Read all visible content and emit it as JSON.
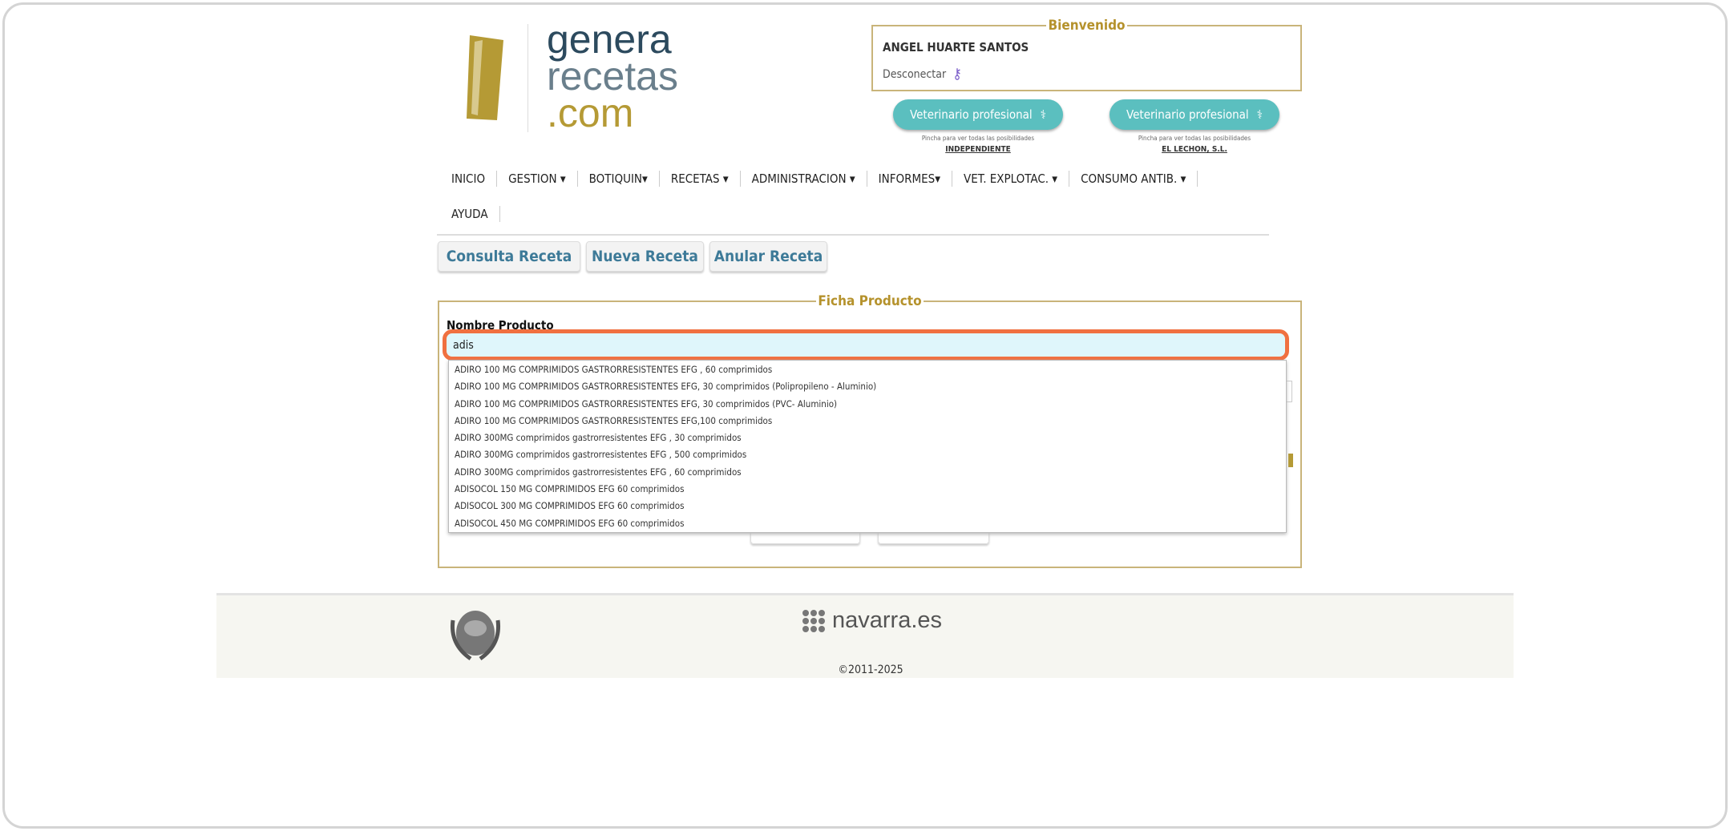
{
  "logo": {
    "line1": "genera",
    "line2": "recetas",
    "line3": ".com"
  },
  "welcome": {
    "legend": "Bienvenido",
    "user": "ANGEL HUARTE SANTOS",
    "disconnect": "Desconectar"
  },
  "vet_buttons": [
    {
      "label": "Veterinario profesional",
      "hint": "Pincha para ver todas las posibilidades",
      "name": "INDEPENDIENTE"
    },
    {
      "label": "Veterinario profesional",
      "hint": "Pincha para ver todas las posibilidades",
      "name": "EL LECHON, S.L."
    }
  ],
  "menu": [
    "INICIO",
    "GESTION ▾",
    "BOTIQUIN▾",
    "RECETAS ▾",
    "ADMINISTRACION ▾",
    "INFORMES▾",
    "VET. EXPLOTAC. ▾",
    "CONSUMO ANTIB. ▾",
    "AYUDA"
  ],
  "tabs": [
    "Consulta Receta",
    "Nueva Receta",
    "Anular Receta"
  ],
  "ficha": {
    "legend": "Ficha Producto",
    "label": "Nombre Producto",
    "value": "adis"
  },
  "suggestions": [
    "ADIRO 100 MG COMPRIMIDOS GASTRORRESISTENTES EFG , 60 comprimidos",
    "ADIRO 100 MG COMPRIMIDOS GASTRORRESISTENTES EFG, 30 comprimidos (Polipropileno - Aluminio)",
    "ADIRO 100 MG COMPRIMIDOS GASTRORRESISTENTES EFG, 30 comprimidos (PVC- Aluminio)",
    "ADIRO 100 MG COMPRIMIDOS GASTRORRESISTENTES EFG,100 comprimidos",
    "ADIRO 300MG comprimidos gastrorresistentes EFG , 30 comprimidos",
    "ADIRO 300MG comprimidos gastrorresistentes EFG , 500 comprimidos",
    "ADIRO 300MG comprimidos gastrorresistentes EFG , 60 comprimidos",
    "ADISOCOL 150 MG COMPRIMIDOS EFG 60 comprimidos",
    "ADISOCOL 300 MG COMPRIMIDOS EFG 60 comprimidos",
    "ADISOCOL 450 MG COMPRIMIDOS EFG 60 comprimidos"
  ],
  "footer": {
    "brand": "navarra.es",
    "copyright": "©2011-2025"
  }
}
